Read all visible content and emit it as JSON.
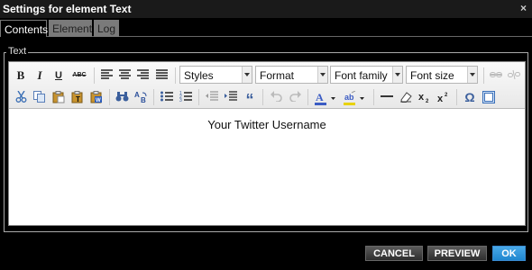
{
  "window": {
    "title": "Settings for element Text",
    "close_glyph": "×"
  },
  "tabs": [
    {
      "label": "Contents",
      "active": true
    },
    {
      "label": "Element",
      "active": false
    },
    {
      "label": "Log",
      "active": false
    }
  ],
  "fieldset": {
    "legend": "Text"
  },
  "toolbar": {
    "combos": {
      "styles": "Styles",
      "format": "Format",
      "font_family": "Font family",
      "font_size": "Font size"
    },
    "labels": {
      "bold": "B",
      "italic": "I",
      "underline": "U",
      "strike": "ABC",
      "blockquote": "“",
      "omega": "Ω"
    }
  },
  "editor": {
    "content": "Your Twitter Username"
  },
  "buttons": {
    "cancel": "CANCEL",
    "preview": "PREVIEW",
    "ok": "OK"
  },
  "colors": {
    "accent": "#2a8fd8",
    "text_color_swatch": "#3b5cc4",
    "highlight_swatch": "#e8d200"
  }
}
